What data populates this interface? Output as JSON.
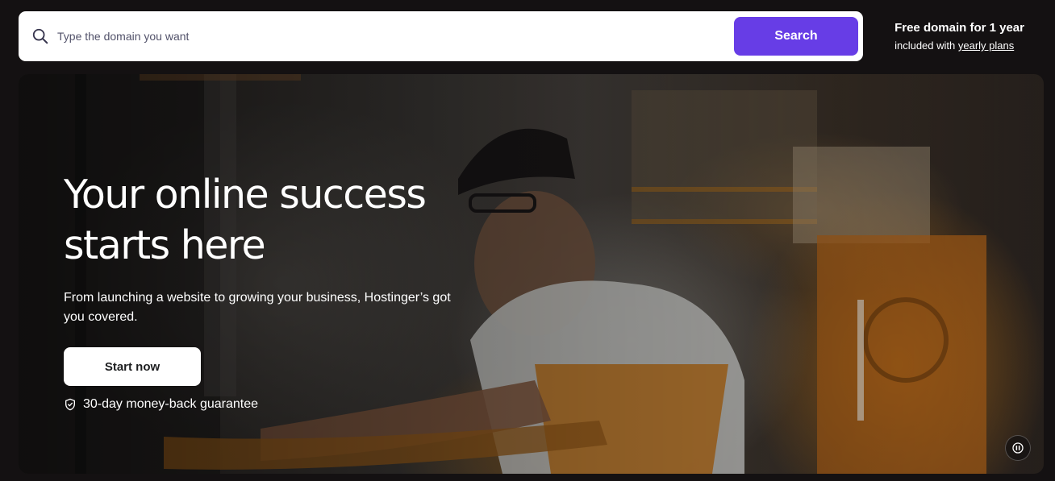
{
  "search": {
    "placeholder": "Type the domain you want",
    "button_label": "Search"
  },
  "promo": {
    "title": "Free domain for 1 year",
    "sub_prefix": "included with",
    "link_label": "yearly plans"
  },
  "hero": {
    "title_line1": "Your online success",
    "title_line2": "starts here",
    "subtitle": "From launching a website to growing your business, Hostinger’s got you covered.",
    "cta_label": "Start now",
    "guarantee": "30-day money-back guarantee"
  },
  "icons": {
    "search": "search-icon",
    "guarantee": "shield-check-icon",
    "video_control": "pause-icon"
  },
  "colors": {
    "accent": "#673de6",
    "page_background": "#141112",
    "search_background": "#ffffff",
    "cta_background": "#ffffff"
  }
}
